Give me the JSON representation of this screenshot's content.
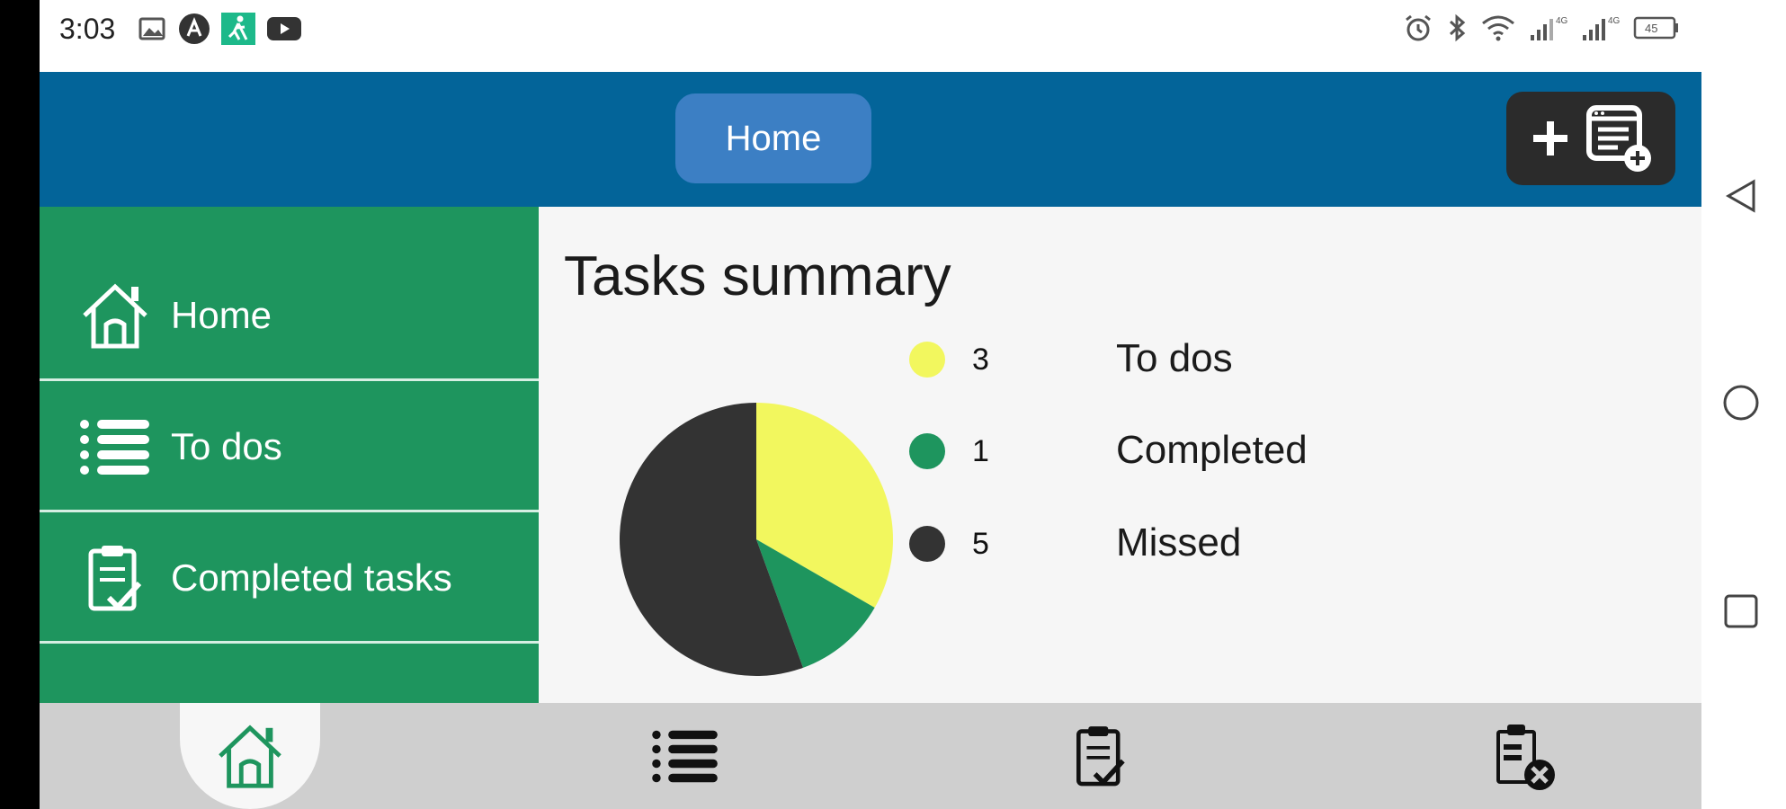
{
  "status_bar": {
    "time": "3:03",
    "left_icons": [
      "image-icon",
      "app-a-icon",
      "walker-icon",
      "youtube-icon"
    ],
    "right_icons": [
      "alarm-icon",
      "bluetooth-icon",
      "wifi-icon",
      "signal-icon",
      "signal-icon",
      "battery-icon"
    ],
    "battery_level": "45"
  },
  "header": {
    "home_label": "Home",
    "add_icon": "add-task-icon",
    "bg_color": "#036499"
  },
  "sidebar": {
    "bg_color": "#1e955e",
    "items": [
      {
        "label": "Home",
        "icon": "home-icon"
      },
      {
        "label": "To dos",
        "icon": "list-icon"
      },
      {
        "label": "Completed tasks",
        "icon": "clipboard-check-icon"
      }
    ]
  },
  "main": {
    "title": "Tasks summary"
  },
  "chart_data": {
    "type": "pie",
    "title": "",
    "slices": [
      {
        "label": "To dos",
        "value": 3,
        "color": "#f2f75e"
      },
      {
        "label": "Completed",
        "value": 1,
        "color": "#1e955e"
      },
      {
        "label": "Missed",
        "value": 5,
        "color": "#333333"
      }
    ],
    "legend_placement": "right"
  },
  "bottom_nav": {
    "items": [
      {
        "icon": "home-icon",
        "active": true
      },
      {
        "icon": "list-icon",
        "active": false
      },
      {
        "icon": "clipboard-check-icon",
        "active": false
      },
      {
        "icon": "clipboard-x-icon",
        "active": false
      }
    ]
  },
  "system_nav": {
    "icons": [
      "back-icon",
      "home-circle-icon",
      "recents-icon"
    ]
  }
}
